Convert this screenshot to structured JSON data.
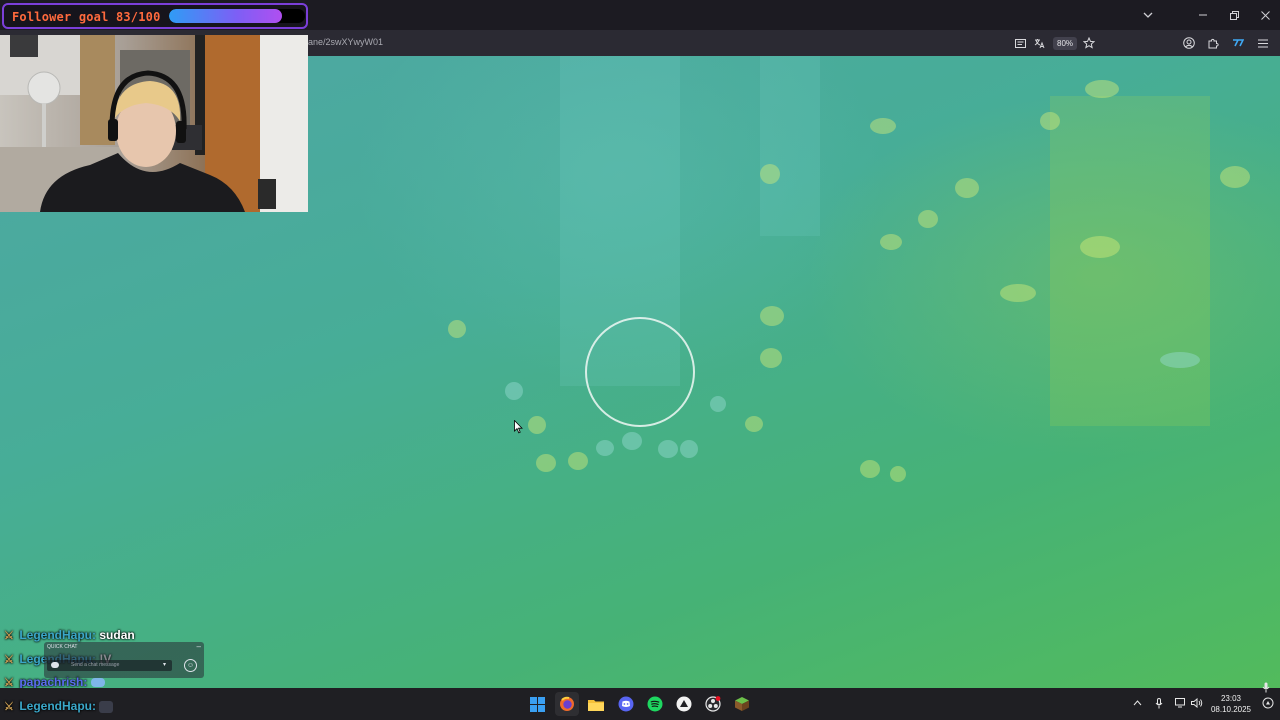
{
  "overlay": {
    "goal_text": "Follower goal 83/100",
    "goal_fraction": 0.83,
    "goal_colors": {
      "border": "#7b3fd9",
      "text": "#ff6a3d",
      "fill_start": "#2f9cf5",
      "fill_end": "#b04ff0"
    }
  },
  "browser": {
    "url_fragment": "ane/2swXYwyW01",
    "zoom": "80%",
    "window_controls": [
      "chevron-down-icon",
      "minimize-icon",
      "restore-icon",
      "close-icon"
    ],
    "toolbar_icons": [
      "reader-view-icon",
      "translate-icon",
      "bookmark-star-icon",
      "account-icon",
      "extensions-icon",
      "extension-icon",
      "menu-icon"
    ]
  },
  "chat": {
    "lines": [
      {
        "user": "LegendHapu:",
        "message": "sudan"
      },
      {
        "user": "LegendHapu:",
        "message": "!V"
      },
      {
        "user": "papachrish:",
        "message": ""
      }
    ],
    "bottom_line": {
      "user": "LegendHapu:",
      "message": ""
    }
  },
  "quick_chat": {
    "title": "QUICK CHAT",
    "placeholder": "Send a chat message",
    "close": "–"
  },
  "taskbar": {
    "apps": [
      "windows-start-icon",
      "firefox-icon",
      "file-explorer-icon",
      "discord-icon",
      "spotify-icon",
      "app-icon",
      "obs-icon",
      "minecraft-icon"
    ],
    "time": "23:03",
    "date": "08.10.2025"
  }
}
